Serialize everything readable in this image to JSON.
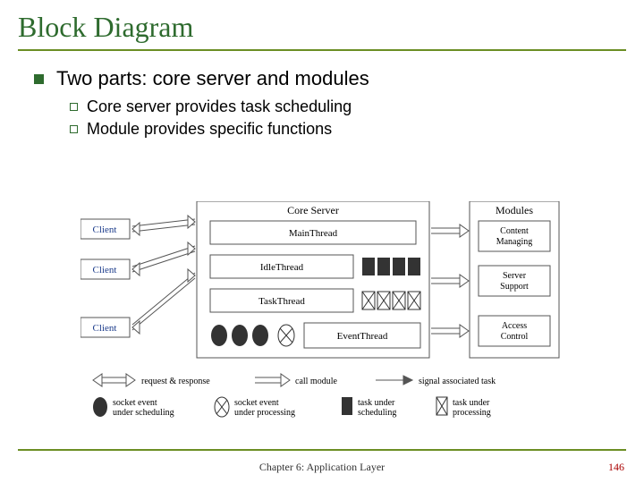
{
  "title": "Block Diagram",
  "bullets": {
    "lvl1": "Two parts: core server and modules",
    "lvl2a": "Core server provides task scheduling",
    "lvl2b": "Module provides specific functions"
  },
  "diagram": {
    "clients": [
      "Client",
      "Client",
      "Client"
    ],
    "core_label": "Core Server",
    "core_boxes": {
      "main": "MainThread",
      "idle": "IdleThread",
      "task": "TaskThread",
      "event": "EventThread"
    },
    "modules_label": "Modules",
    "modules": [
      "Content Managing",
      "Server Support",
      "Access Control"
    ],
    "legend_arrows": {
      "reqresp": "request & response",
      "callmod": "call module",
      "signal": "signal associated task"
    },
    "legend_ovals": {
      "sched": "socket event under scheduling",
      "proc": "socket event under processing",
      "tsched": "task under scheduling",
      "tproc": "task under processing"
    }
  },
  "footer": "Chapter 6: Application Layer",
  "pagenum": "146"
}
